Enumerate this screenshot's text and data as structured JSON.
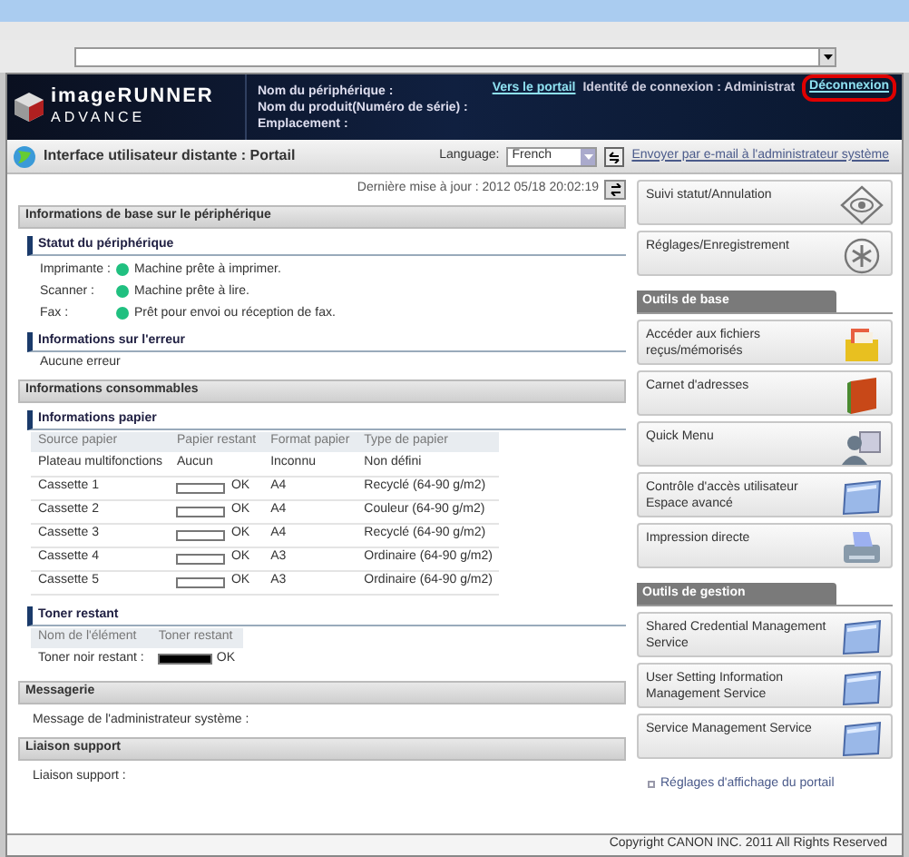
{
  "header": {
    "logo_line1": "imageRUNNER",
    "logo_line2": "ADVANCE",
    "device_fields": [
      "Nom du périphérique :",
      "Nom du produit(Numéro de série) :",
      "Emplacement :"
    ],
    "portal_link": "Vers le portail",
    "login_id": "Identité de connexion : Administrat",
    "logout": "Déconnexion"
  },
  "portal_bar": {
    "title": "Interface utilisateur distante : Portail",
    "language_label": "Language:",
    "language_value": "French",
    "email_link": "Envoyer par e-mail à l'administrateur système"
  },
  "last_update": "Dernière mise à jour : 2012 05/18 20:02:19",
  "basic_info": {
    "title": "Informations de base sur le périphérique",
    "status_title": "Statut du périphérique",
    "statuses": [
      {
        "label": "Imprimante :",
        "text": "Machine prête à imprimer."
      },
      {
        "label": "Scanner :",
        "text": "Machine prête à lire."
      },
      {
        "label": "Fax :",
        "text": "Prêt pour envoi ou réception de fax."
      }
    ],
    "error_title": "Informations sur l'erreur",
    "error_text": "Aucune erreur"
  },
  "consumables": {
    "title": "Informations consommables",
    "paper_title": "Informations papier",
    "paper_columns": [
      "Source papier",
      "Papier restant",
      "Format papier",
      "Type de papier"
    ],
    "paper_rows": [
      {
        "kind": "text",
        "source": "Plateau multifonctions",
        "remaining": "Aucun",
        "format": "Inconnu",
        "type": "Non défini"
      },
      {
        "kind": "bar",
        "source": "Cassette 1",
        "remaining": "OK",
        "format": "A4",
        "type": "Recyclé (64-90 g/m2)"
      },
      {
        "kind": "bar",
        "source": "Cassette 2",
        "remaining": "OK",
        "format": "A4",
        "type": "Couleur (64-90 g/m2)"
      },
      {
        "kind": "bar",
        "source": "Cassette 3",
        "remaining": "OK",
        "format": "A4",
        "type": "Recyclé (64-90 g/m2)"
      },
      {
        "kind": "bar",
        "source": "Cassette 4",
        "remaining": "OK",
        "format": "A3",
        "type": "Ordinaire (64-90 g/m2)"
      },
      {
        "kind": "bar",
        "source": "Cassette 5",
        "remaining": "OK",
        "format": "A3",
        "type": "Ordinaire (64-90 g/m2)"
      }
    ],
    "toner_title": "Toner restant",
    "toner_columns": [
      "Nom de l'élément",
      "Toner restant"
    ],
    "toner_rows": [
      {
        "name": "Toner noir restant :",
        "level": 1,
        "status": "OK"
      }
    ]
  },
  "messaging": {
    "title": "Messagerie",
    "text": "Message de l'administrateur système :"
  },
  "support": {
    "title": "Liaison support",
    "text": "Liaison support :"
  },
  "top_buttons": [
    {
      "label": "Suivi statut/Annulation",
      "kind": "eye"
    },
    {
      "label": "Réglages/Enregistrement",
      "kind": "gear"
    }
  ],
  "groups": [
    {
      "title": "Outils de base",
      "items": [
        {
          "label": "Accéder aux fichiers reçus/mémorisés",
          "kind": "box"
        },
        {
          "label": "Carnet d'adresses",
          "kind": "book"
        },
        {
          "label": "Quick Menu",
          "kind": "person"
        },
        {
          "label": "Contrôle d'accès utilisateur Espace avancé",
          "kind": "window"
        },
        {
          "label": "Impression directe",
          "kind": "printer"
        }
      ]
    },
    {
      "title": "Outils de gestion",
      "items": [
        {
          "label": "Shared Credential Management Service",
          "kind": "window"
        },
        {
          "label": "User Setting Information Management Service",
          "kind": "window"
        },
        {
          "label": "Service Management Service",
          "kind": "window"
        }
      ]
    }
  ],
  "portal_settings_link": "Réglages d'affichage du portail",
  "copyright": "Copyright CANON INC. 2011 All Rights Reserved"
}
